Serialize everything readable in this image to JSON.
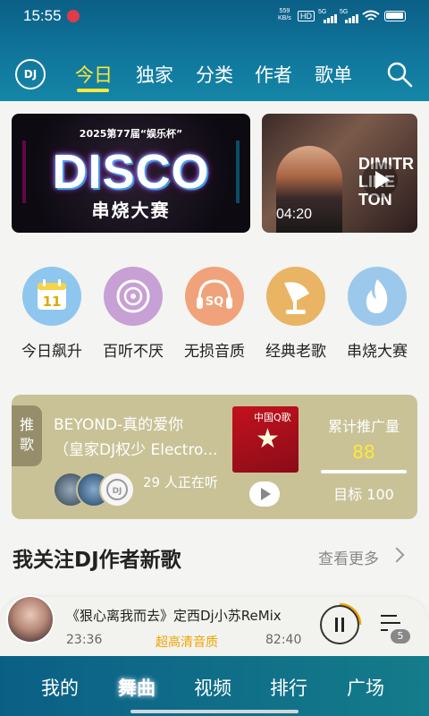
{
  "status": {
    "time": "15:55",
    "net_speed": "559",
    "net_unit": "KB/s",
    "hd": "HD",
    "sig1": "5G",
    "sig2": "5G"
  },
  "header": {
    "logo": "DJ",
    "tabs": [
      {
        "label": "今日",
        "active": true
      },
      {
        "label": "独家"
      },
      {
        "label": "分类"
      },
      {
        "label": "作者"
      },
      {
        "label": "歌单"
      }
    ],
    "accent": "#ffe83a"
  },
  "banners": [
    {
      "top_text": "2025第77届“娱乐杯”",
      "main": "DISCO",
      "sub": "串烧大赛"
    },
    {
      "title_line1": "DIMITR",
      "title_line2": "LIKE",
      "title_line3": "TON",
      "duration": "04:20"
    }
  ],
  "categories": [
    {
      "label": "今日飙升",
      "icon": "calendar-icon",
      "color": "#8ec6ee",
      "glyph": "11"
    },
    {
      "label": "百听不厌",
      "icon": "disc-icon",
      "color": "#c7a0d6"
    },
    {
      "label": "无损音质",
      "icon": "headphones-sq-icon",
      "color": "#f0a37a",
      "glyph": "SQ"
    },
    {
      "label": "经典老歌",
      "icon": "gramophone-icon",
      "color": "#e9b464"
    },
    {
      "label": "串烧大赛",
      "icon": "flame-icon",
      "color": "#9cc8ec"
    }
  ],
  "promo": {
    "tag": "推歌",
    "song_line1": "BEYOND-真的爱你",
    "song_line2": "（皇家DJ权少 Electro...",
    "listeners": "29 人正在听",
    "cover_text": "中国Q歌",
    "total_label": "累计推广量",
    "total_value": "88",
    "goal": "目标 100"
  },
  "section": {
    "title": "我关注DJ作者新歌",
    "more": "查看更多"
  },
  "player": {
    "title": "《狠心离我而去》定西Dj小苏ReMix",
    "current": "23:36",
    "quality": "超高清音质",
    "total": "82:40",
    "queue_count": "5"
  },
  "bottom_nav": [
    {
      "label": "我的"
    },
    {
      "label": "舞曲",
      "active": true
    },
    {
      "label": "视频"
    },
    {
      "label": "排行"
    },
    {
      "label": "广场"
    }
  ]
}
